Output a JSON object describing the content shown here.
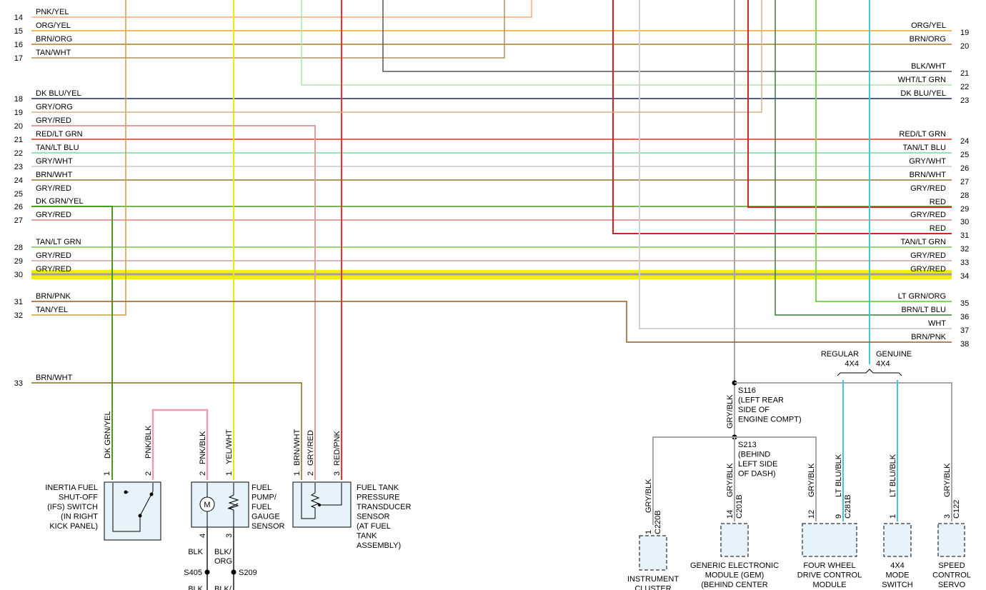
{
  "colors": {
    "bg": "#ffffff",
    "component_fill": "#e6f3fb",
    "highlight": "#f3ef00"
  },
  "left_circuits": [
    {
      "num": "14",
      "label": "PNK/YEL",
      "color": "#f2a97b"
    },
    {
      "num": "15",
      "label": "ORG/YEL",
      "color": "#f5a31a"
    },
    {
      "num": "16",
      "label": "BRN/ORG",
      "color": "#b07a2a"
    },
    {
      "num": "17",
      "label": "TAN/WHT",
      "color": "#b09060"
    },
    {
      "num": "18",
      "label": "DK BLU/YEL",
      "color": "#1a2a6a"
    },
    {
      "num": "19",
      "label": "GRY/ORG",
      "color": "#d9b08a"
    },
    {
      "num": "20",
      "label": "GRY/RED",
      "color": "#e0a0a0"
    },
    {
      "num": "21",
      "label": "RED/LT GRN",
      "color": "#e03020"
    },
    {
      "num": "22",
      "label": "TAN/LT BLU",
      "color": "#7cd9a0"
    },
    {
      "num": "23",
      "label": "GRY/WHT",
      "color": "#c8c8c8"
    },
    {
      "num": "24",
      "label": "BRN/WHT",
      "color": "#9a7530"
    },
    {
      "num": "25",
      "label": "GRY/RED",
      "color": "#e0a0a0"
    },
    {
      "num": "26",
      "label": "DK GRN/YEL",
      "color": "#4a9a20"
    },
    {
      "num": "27",
      "label": "GRY/RED",
      "color": "#e08080"
    },
    {
      "num": "28",
      "label": "TAN/LT GRN",
      "color": "#7cc44a"
    },
    {
      "num": "29",
      "label": "GRY/RED",
      "color": "#d0a0a0"
    },
    {
      "num": "30",
      "label": "GRY/RED",
      "color": "#a0a0a0"
    },
    {
      "num": "31",
      "label": "BRN/PNK",
      "color": "#9a5a20"
    },
    {
      "num": "32",
      "label": "TAN/YEL",
      "color": "#c8a040"
    },
    {
      "num": "33",
      "label": "BRN/WHT",
      "color": "#8a6a20"
    }
  ],
  "right_circuits": [
    {
      "num": "19",
      "label": "ORG/YEL",
      "color": "#f5a31a"
    },
    {
      "num": "20",
      "label": "BRN/ORG",
      "color": "#b07a2a"
    },
    {
      "num": "21",
      "label": "BLK/WHT",
      "color": "#555555"
    },
    {
      "num": "22",
      "label": "WHT/LT GRN",
      "color": "#a8e8a8"
    },
    {
      "num": "23",
      "label": "DK BLU/YEL",
      "color": "#1a2a6a"
    },
    {
      "num": "24",
      "label": "RED/LT GRN",
      "color": "#e03020"
    },
    {
      "num": "25",
      "label": "TAN/LT BLU",
      "color": "#7cd9a0"
    },
    {
      "num": "26",
      "label": "GRY/WHT",
      "color": "#c8c8c8"
    },
    {
      "num": "27",
      "label": "BRN/WHT",
      "color": "#9a7530"
    },
    {
      "num": "28",
      "label": "GRY/RED",
      "color": "#e0a0a0"
    },
    {
      "num": "29",
      "label": "RED",
      "color": "#e02020"
    },
    {
      "num": "30",
      "label": "GRY/RED",
      "color": "#e08080"
    },
    {
      "num": "31",
      "label": "RED",
      "color": "#e02020"
    },
    {
      "num": "32",
      "label": "TAN/LT GRN",
      "color": "#7cc44a"
    },
    {
      "num": "33",
      "label": "GRY/RED",
      "color": "#d0a0a0"
    },
    {
      "num": "34",
      "label": "GRY/RED",
      "color": "#a0a0a0"
    },
    {
      "num": "35",
      "label": "LT GRN/ORG",
      "color": "#7ed957"
    },
    {
      "num": "36",
      "label": "BRN/LT BLU",
      "color": "#3a7a3a"
    },
    {
      "num": "37",
      "label": "WHT",
      "color": "#d0d0d0"
    },
    {
      "num": "38",
      "label": "BRN/PNK",
      "color": "#9a5a20"
    }
  ],
  "components": {
    "ifs": {
      "lines": [
        "INERTIA FUEL",
        "SHUT-OFF",
        "(IFS) SWITCH",
        "(IN RIGHT",
        "KICK PANEL)"
      ],
      "pins": [
        "1",
        "2"
      ],
      "wires": [
        "DK GRN/YEL",
        "PNK/BLK"
      ]
    },
    "pump": {
      "lines": [
        "FUEL",
        "PUMP/",
        "FUEL",
        "GAUGE",
        "SENSOR"
      ],
      "pins": [
        "2",
        "1",
        "4",
        "3"
      ],
      "wires": [
        "PNK/BLK",
        "YEL/WHT"
      ],
      "motor": "M",
      "bottom_wires": [
        "BLK",
        "BLK/",
        "ORG"
      ],
      "splices": [
        "S405",
        "S209"
      ],
      "cut_labels": [
        "BLK",
        "BLK/"
      ]
    },
    "transducer": {
      "lines": [
        "FUEL TANK",
        "PRESSURE",
        "TRANSDUCER",
        "SENSOR",
        "(AT FUEL",
        "TANK",
        "ASSEMBLY)"
      ],
      "pins": [
        "1",
        "2",
        "3"
      ],
      "wires": [
        "BRN/WHT",
        "GRY/RED",
        "RED/PNK"
      ]
    }
  },
  "splices": {
    "s116": {
      "lines": [
        "S116",
        "(LEFT REAR",
        "SIDE OF",
        "ENGINE COMPT)"
      ]
    },
    "s213": {
      "lines": [
        "S213",
        "(BEHIND",
        "LEFT SIDE",
        "OF DASH)"
      ]
    },
    "wire_s116": "GRY/BLK",
    "wire_s213": "GRY/BLK"
  },
  "options": {
    "regular": [
      "REGULAR",
      "4X4"
    ],
    "genuine": [
      "GENUINE",
      "4X4"
    ]
  },
  "modules": [
    {
      "wire": "GRY/BLK",
      "pin": "1",
      "conn": "C220B",
      "lines": [
        "INSTRUMENT",
        "CLUSTER"
      ]
    },
    {
      "wire": "GRY/BLK",
      "pin": "14",
      "conn": "C201B",
      "lines": [
        "GENERIC ELECTRONIC",
        "MODULE (GEM)",
        "(BEHIND CENTER"
      ]
    },
    {
      "wire": "GRY/BLK",
      "pin": "12",
      "conn": "",
      "lines": [
        "FOUR WHEEL",
        "DRIVE CONTROL",
        "MODULE"
      ]
    },
    {
      "wire": "LT BLU/BLK",
      "pin": "9",
      "conn": "C281B",
      "lines": []
    },
    {
      "wire": "LT BLU/BLK",
      "pin": "1",
      "conn": "",
      "lines": [
        "4X4",
        "MODE",
        "SWITCH"
      ]
    },
    {
      "wire": "GRY/BLK",
      "pin": "3",
      "conn": "C122",
      "lines": [
        "SPEED",
        "CONTROL",
        "SERVO"
      ]
    }
  ]
}
